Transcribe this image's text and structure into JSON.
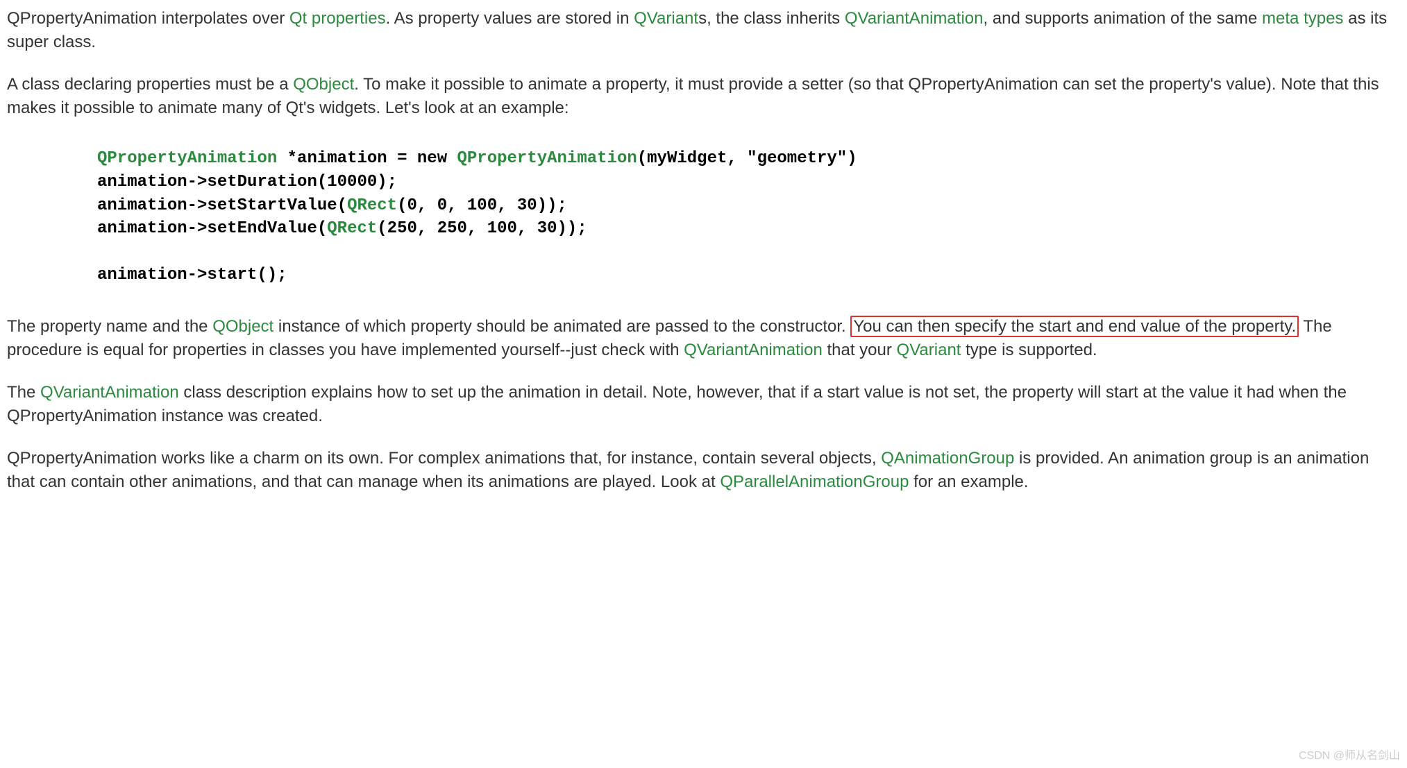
{
  "p1": {
    "t0": "QPropertyAnimation interpolates over ",
    "l1": "Qt properties",
    "t1": ". As property values are stored in ",
    "l2": "QVariant",
    "t2": "s, the class inherits ",
    "l3": "QVariantAnimation",
    "t3": ", and supports animation of the same ",
    "l4": "meta types",
    "t4": " as its super class."
  },
  "p2": {
    "t0": "A class declaring properties must be a ",
    "l1": "QObject",
    "t1": ". To make it possible to animate a property, it must provide a setter (so that QPropertyAnimation can set the property's value). Note that this makes it possible to animate many of Qt's widgets. Let's look at an example:"
  },
  "code": {
    "l1a": "QPropertyAnimation",
    "l1b": " *animation = new ",
    "l1c": "QPropertyAnimation",
    "l1d": "(myWidget, \"geometry\")",
    "l2": "animation->setDuration(10000);",
    "l3a": "animation->setStartValue(",
    "l3b": "QRect",
    "l3c": "(0, 0, 100, 30));",
    "l4a": "animation->setEndValue(",
    "l4b": "QRect",
    "l4c": "(250, 250, 100, 30));",
    "l5": "animation->start();"
  },
  "p3": {
    "t0": "The property name and the ",
    "l1": "QObject",
    "t1": " instance of which property should be animated are passed to the constructor. ",
    "hl": "You can then specify the start and end value of the property.",
    "t2": " The procedure is equal for properties in classes you have implemented yourself--just check with ",
    "l2": "QVariantAnimation",
    "t3": " that your ",
    "l3": "QVariant",
    "t4": " type is supported."
  },
  "p4": {
    "t0": "The ",
    "l1": "QVariantAnimation",
    "t1": " class description explains how to set up the animation in detail. Note, however, that if a start value is not set, the property will start at the value it had when the QPropertyAnimation instance was created."
  },
  "p5": {
    "t0": "QPropertyAnimation works like a charm on its own. For complex animations that, for instance, contain several objects, ",
    "l1": "QAnimationGroup",
    "t1": " is provided. An animation group is an animation that can contain other animations, and that can manage when its animations are played. Look at ",
    "l2": "QParallelAnimationGroup",
    "t2": " for an example."
  },
  "watermark": "CSDN @师从名剑山"
}
